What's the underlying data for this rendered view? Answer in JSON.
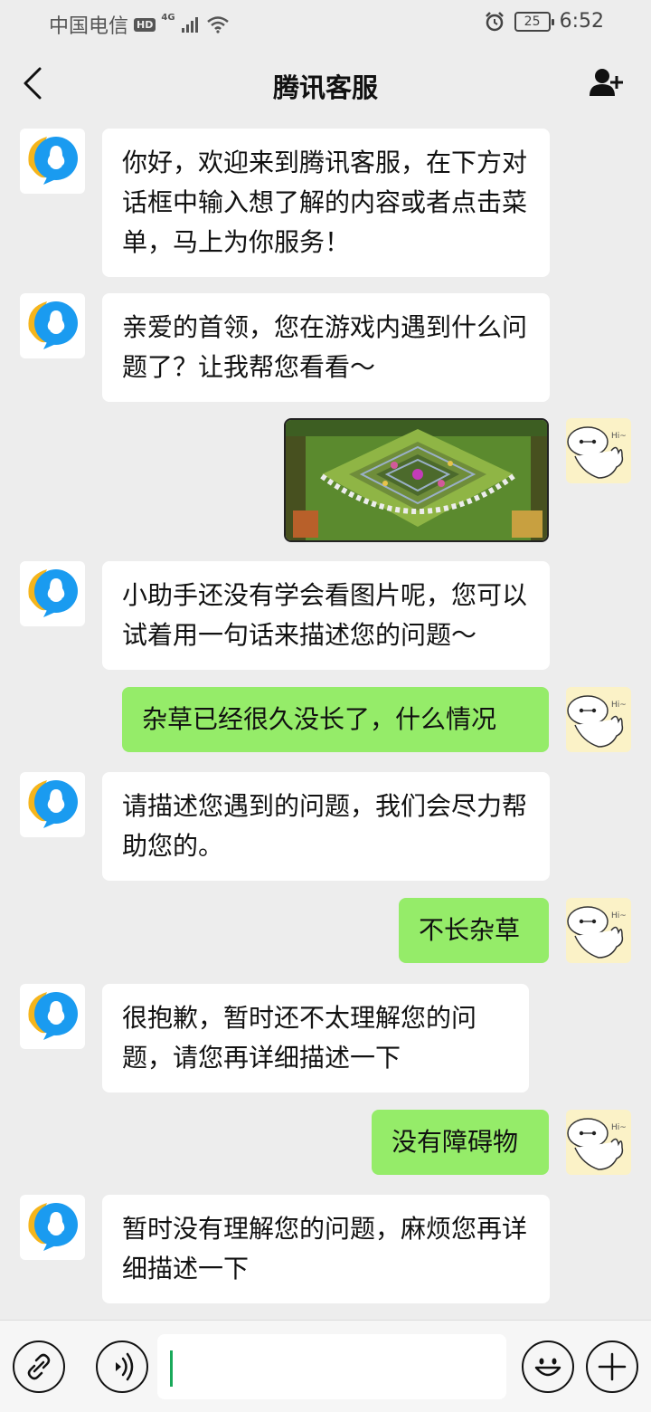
{
  "status_bar": {
    "carrier": "中国电信",
    "hd": "HD",
    "network": "4G",
    "battery": "25",
    "time": "6:52"
  },
  "nav": {
    "title": "腾讯客服"
  },
  "messages": [
    {
      "side": "left",
      "text": "你好，欢迎来到腾讯客服，在下方对话框中输入想了解的内容或者点击菜单，马上为你服务！"
    },
    {
      "side": "left",
      "text": "亲爱的首领，您在游戏内遇到什么问题了？让我帮您看看～"
    },
    {
      "side": "right",
      "type": "image",
      "content": "game-screenshot"
    },
    {
      "side": "left",
      "text": "小助手还没有学会看图片呢，您可以试着用一句话来描述您的问题～"
    },
    {
      "side": "right",
      "text": "杂草已经很久没长了，什么情况"
    },
    {
      "side": "left",
      "text": "请描述您遇到的问题，我们会尽力帮助您的。"
    },
    {
      "side": "right",
      "text": "不长杂草"
    },
    {
      "side": "left",
      "text": "很抱歉，暂时还不太理解您的问题，请您再详细描述一下"
    },
    {
      "side": "right",
      "text": "没有障碍物"
    },
    {
      "side": "left",
      "text": "暂时没有理解您的问题，麻烦您再详细描述一下"
    }
  ],
  "avatar_text": "Hi~",
  "input": {
    "value": ""
  },
  "icons": {
    "back": "chevron-left-icon",
    "add_friend": "add-user-icon",
    "menu": "link-icon",
    "voice": "voice-icon",
    "emoji": "smile-icon",
    "more": "plus-icon"
  },
  "colors": {
    "background": "#ededed",
    "bubble_left": "#ffffff",
    "bubble_right": "#95ec69",
    "caret": "#19a95a"
  }
}
